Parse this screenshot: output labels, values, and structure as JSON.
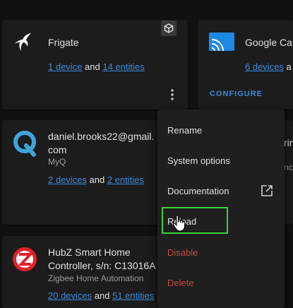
{
  "cards": {
    "frigate": {
      "title": "Frigate",
      "devices_link": "1 device",
      "and": "and",
      "entities_link": "14 entities"
    },
    "cast": {
      "title": "Google Ca",
      "devices_link": "6 devices",
      "and": "a",
      "configure": "CONFIGURE"
    },
    "myq": {
      "title_line1": "daniel.brooks22@gmail.",
      "title_line2": "com",
      "subtitle": "MyQ",
      "devices_link": "2 devices",
      "and": "and",
      "entities_link": "2 entities",
      "edge_1": "rin",
      "edge_2": "nc"
    },
    "zha": {
      "title_line1": "HubZ Smart Home",
      "title_line2": "Controller, s/n: C13016A",
      "subtitle": "Zigbee Home Automation",
      "devices_link": "20 devices",
      "and": "and",
      "entities_link": "51 entities"
    }
  },
  "menu": {
    "items": [
      {
        "label": "Rename"
      },
      {
        "label": "System options"
      },
      {
        "label": "Documentation"
      },
      {
        "label": "Reload"
      },
      {
        "label": "Disable"
      },
      {
        "label": "Delete"
      }
    ]
  },
  "colors": {
    "link": "#3c8bdc",
    "danger": "#c24a40",
    "highlight": "#39d23a",
    "myq": "#3fa4d8",
    "zha": "#e2202c"
  }
}
